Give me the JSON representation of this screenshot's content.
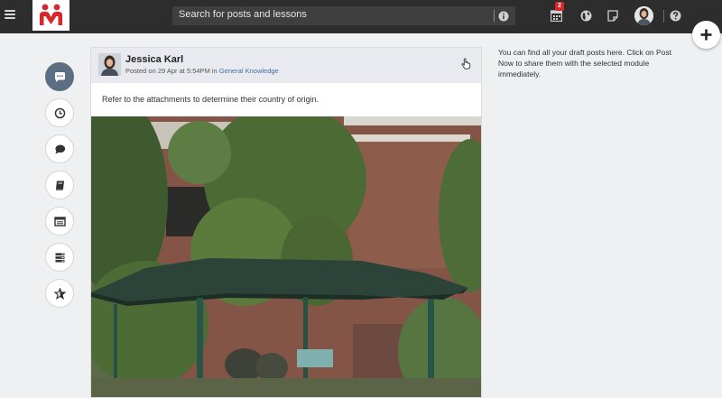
{
  "topbar": {
    "search_placeholder": "Search for posts and lessons",
    "calendar_badge": "2",
    "icons": [
      "menu-icon",
      "logo",
      "info-icon",
      "calendar-icon",
      "globe-icon",
      "note-icon",
      "user-avatar",
      "help-icon"
    ],
    "background": "#2d2d2e"
  },
  "rail": {
    "items": [
      "posts-icon",
      "clock-icon",
      "chat-icon",
      "book-icon",
      "list-card-icon",
      "stack-icon",
      "star-icon"
    ],
    "active_color": "#5c6f82"
  },
  "post": {
    "author": "Jessica Karl",
    "posted_prefix": "Posted on 29 Apr at 5:54PM in ",
    "module": "General Knowledge",
    "text": "Refer to the attachments to determine their country of origin."
  },
  "side_note": "You can find all your draft posts here. Click on Post Now to share them with the selected module immediately.",
  "colors": {
    "accent_red": "#d8262b",
    "link_blue": "#3f6ea0",
    "page_bg": "#eff0f2"
  }
}
